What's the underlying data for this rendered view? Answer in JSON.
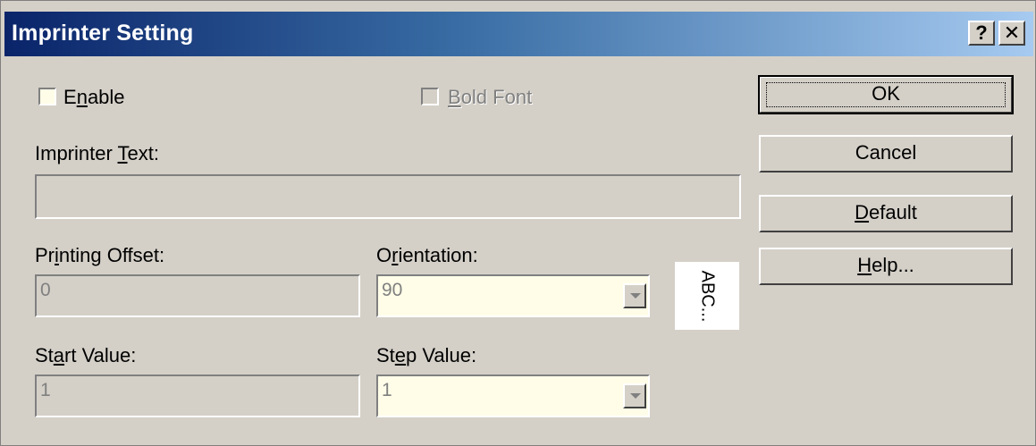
{
  "window": {
    "title": "Imprinter Setting",
    "help_button": "?",
    "close_button": "✕"
  },
  "enable": {
    "pre": "E",
    "key": "n",
    "post": "able",
    "checked": false
  },
  "bold_font": {
    "pre": "",
    "key": "B",
    "post": "old Font",
    "checked": false,
    "disabled": true
  },
  "imprinter_text": {
    "pre": "Imprinter ",
    "key": "T",
    "post": "ext:",
    "value": ""
  },
  "printing_offset": {
    "pre": "Pr",
    "key": "i",
    "post": "nting Offset:",
    "value": "0"
  },
  "orientation": {
    "pre": "O",
    "key": "r",
    "post": "ientation:",
    "value": "90",
    "preview": "ABC..."
  },
  "start_value": {
    "pre": "St",
    "key": "a",
    "post": "rt Value:",
    "value": "1"
  },
  "step_value": {
    "pre": "St",
    "key": "e",
    "post": "p Value:",
    "value": "1"
  },
  "buttons": {
    "ok": {
      "pre": "OK",
      "key": "",
      "post": ""
    },
    "cancel": {
      "pre": "Cancel",
      "key": "",
      "post": ""
    },
    "default": {
      "pre": "",
      "key": "D",
      "post": "efault"
    },
    "help": {
      "pre": "",
      "key": "H",
      "post": "elp..."
    }
  }
}
